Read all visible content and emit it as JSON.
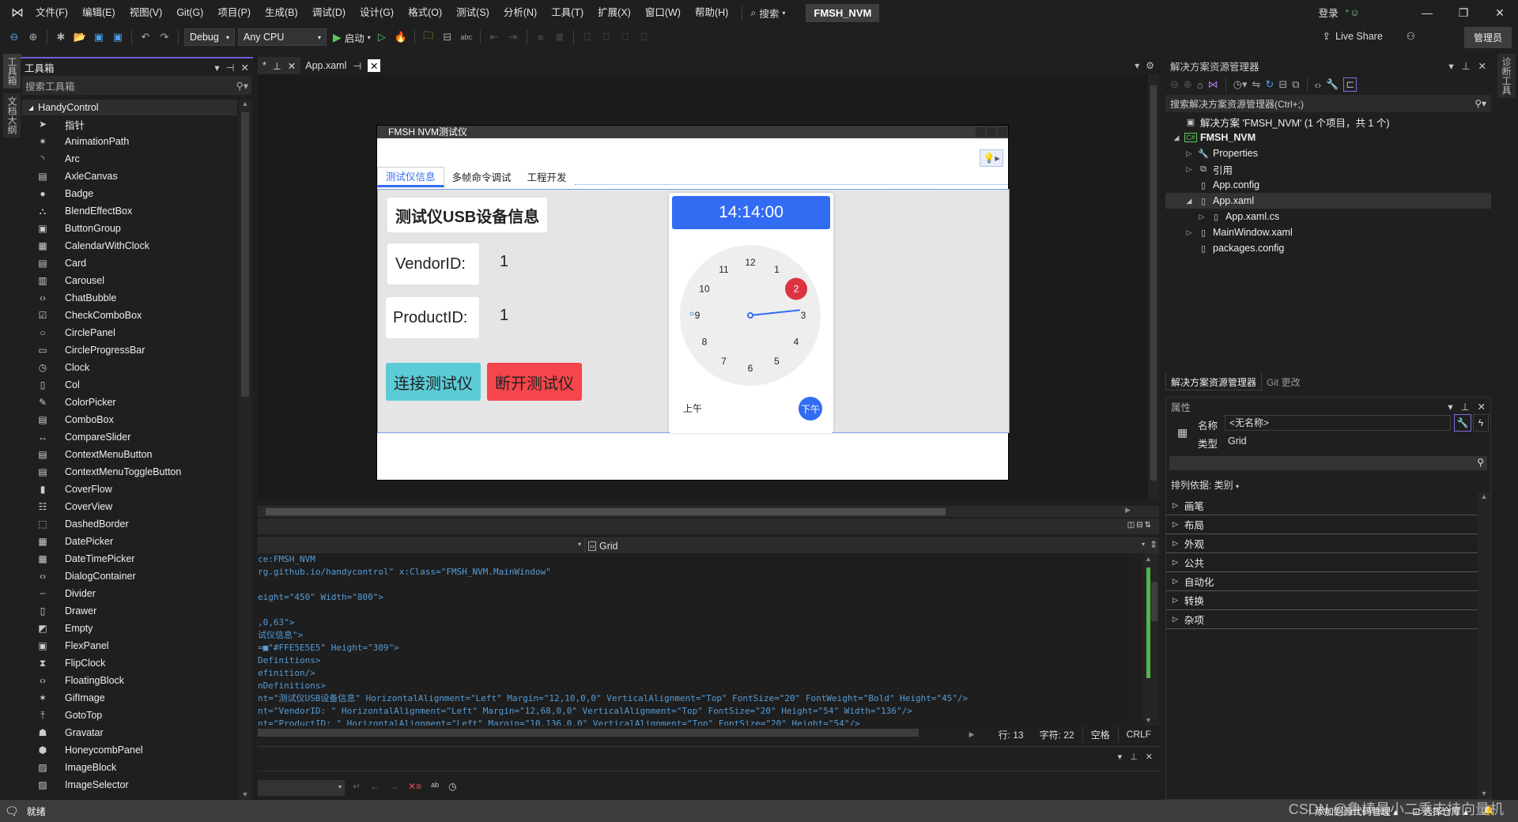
{
  "menubar": {
    "items": [
      "文件(F)",
      "编辑(E)",
      "视图(V)",
      "Git(G)",
      "项目(P)",
      "生成(B)",
      "调试(D)",
      "设计(G)",
      "格式(O)",
      "测试(S)",
      "分析(N)",
      "工具(T)",
      "扩展(X)",
      "窗口(W)",
      "帮助(H)"
    ],
    "search_label": "搜索",
    "solution_name": "FMSH_NVM",
    "login_label": "登录"
  },
  "toolbar": {
    "config": "Debug",
    "platform": "Any CPU",
    "start_label": "启动",
    "live_share": "Live Share",
    "admin_label": "管理员"
  },
  "left_tabs": [
    "工具箱",
    "文档大纲"
  ],
  "toolbox": {
    "title": "工具箱",
    "search_placeholder": "搜索工具箱",
    "group": "HandyControl",
    "items": [
      {
        "label": "指针",
        "icon": "pointer-icon",
        "glyph": "➤"
      },
      {
        "label": "AnimationPath",
        "icon": "animation-path-icon",
        "glyph": "✶"
      },
      {
        "label": "Arc",
        "icon": "arc-icon",
        "glyph": "◝"
      },
      {
        "label": "AxleCanvas",
        "icon": "axle-canvas-icon",
        "glyph": "▤"
      },
      {
        "label": "Badge",
        "icon": "badge-icon",
        "glyph": "●"
      },
      {
        "label": "BlendEffectBox",
        "icon": "blend-effect-icon",
        "glyph": "⛬"
      },
      {
        "label": "ButtonGroup",
        "icon": "button-group-icon",
        "glyph": "▣"
      },
      {
        "label": "CalendarWithClock",
        "icon": "calendar-clock-icon",
        "glyph": "▦"
      },
      {
        "label": "Card",
        "icon": "card-icon",
        "glyph": "▤"
      },
      {
        "label": "Carousel",
        "icon": "carousel-icon",
        "glyph": "▥"
      },
      {
        "label": "ChatBubble",
        "icon": "code-brackets-icon",
        "glyph": "‹›"
      },
      {
        "label": "CheckComboBox",
        "icon": "check-combo-icon",
        "glyph": "☑"
      },
      {
        "label": "CirclePanel",
        "icon": "circle-panel-icon",
        "glyph": "○"
      },
      {
        "label": "CircleProgressBar",
        "icon": "progress-bar-icon",
        "glyph": "▭"
      },
      {
        "label": "Clock",
        "icon": "clock-icon",
        "glyph": "◷"
      },
      {
        "label": "Col",
        "icon": "column-icon",
        "glyph": "▯"
      },
      {
        "label": "ColorPicker",
        "icon": "color-picker-icon",
        "glyph": "✎"
      },
      {
        "label": "ComboBox",
        "icon": "combobox-icon",
        "glyph": "▤"
      },
      {
        "label": "CompareSlider",
        "icon": "compare-slider-icon",
        "glyph": "↔"
      },
      {
        "label": "ContextMenuButton",
        "icon": "context-menu-icon",
        "glyph": "▤"
      },
      {
        "label": "ContextMenuToggleButton",
        "icon": "context-menu-toggle-icon",
        "glyph": "▤"
      },
      {
        "label": "CoverFlow",
        "icon": "cover-flow-icon",
        "glyph": "▮"
      },
      {
        "label": "CoverView",
        "icon": "cover-view-icon",
        "glyph": "☷"
      },
      {
        "label": "DashedBorder",
        "icon": "dashed-border-icon",
        "glyph": "⬚"
      },
      {
        "label": "DatePicker",
        "icon": "date-picker-icon",
        "glyph": "▦"
      },
      {
        "label": "DateTimePicker",
        "icon": "datetime-picker-icon",
        "glyph": "▦"
      },
      {
        "label": "DialogContainer",
        "icon": "code-brackets-icon",
        "glyph": "‹›"
      },
      {
        "label": "Divider",
        "icon": "divider-icon",
        "glyph": "┄"
      },
      {
        "label": "Drawer",
        "icon": "drawer-icon",
        "glyph": "▯"
      },
      {
        "label": "Empty",
        "icon": "empty-icon",
        "glyph": "◩"
      },
      {
        "label": "FlexPanel",
        "icon": "flex-panel-icon",
        "glyph": "▣"
      },
      {
        "label": "FlipClock",
        "icon": "flip-clock-icon",
        "glyph": "⧗"
      },
      {
        "label": "FloatingBlock",
        "icon": "code-brackets-icon",
        "glyph": "‹›"
      },
      {
        "label": "GifImage",
        "icon": "gif-image-icon",
        "glyph": "✶"
      },
      {
        "label": "GotoTop",
        "icon": "goto-top-icon",
        "glyph": "⤒"
      },
      {
        "label": "Gravatar",
        "icon": "gravatar-icon",
        "glyph": "☗"
      },
      {
        "label": "HoneycombPanel",
        "icon": "honeycomb-icon",
        "glyph": "⬢"
      },
      {
        "label": "ImageBlock",
        "icon": "image-block-icon",
        "glyph": "▨"
      },
      {
        "label": "ImageSelector",
        "icon": "image-selector-icon",
        "glyph": "▨"
      }
    ]
  },
  "doc_tabs": [
    {
      "label": "*",
      "active": false
    },
    {
      "label": "App.xaml",
      "active": true
    }
  ],
  "wpf_window": {
    "title": "FMSH NVM测试仪",
    "tabs": [
      "测试仪信息",
      "多帧命令调试",
      "工程开发"
    ],
    "active_tab": 0,
    "heading": "测试仪USB设备信息",
    "vendor_label": "VendorID:",
    "vendor_value": "1",
    "product_label": "ProductID:",
    "product_value": "1",
    "connect_button": "连接测试仪",
    "disconnect_button": "断开测试仪",
    "colors": {
      "connect": "#5bcbd6",
      "disconnect": "#f5464b",
      "accent": "#326cf3",
      "grid_bg": "#e5e5e5"
    },
    "clock": {
      "time": "14:14:00",
      "hour": 2,
      "minute": 14,
      "numbers": [
        "12",
        "1",
        "2",
        "3",
        "4",
        "5",
        "6",
        "7",
        "8",
        "9",
        "10",
        "11"
      ],
      "selected_number": "2",
      "am_label": "上午",
      "pm_label": "下午",
      "pm_selected": true
    }
  },
  "xaml_editor": {
    "element_selector": "Grid",
    "lines": [
      "ce:FMSH_NVM",
      "rg.github.io/handycontrol\" x:Class=\"FMSH_NVM.MainWindow\"",
      "",
      "eight=\"450\" Width=\"800\">",
      "",
      ",0,63\">",
      "试仪信息\">",
      "=■\"#FFE5E5E5\" Height=\"309\">",
      "Definitions>",
      "efinition/>",
      "nDefinitions>",
      "nt=\"测试仪USB设备信息\" HorizontalAlignment=\"Left\" Margin=\"12,10,0,0\" VerticalAlignment=\"Top\" FontSize=\"20\" FontWeight=\"Bold\" Height=\"45\"/>",
      "nt=\"VendorID: \" HorizontalAlignment=\"Left\" Margin=\"12,68,0,0\" VerticalAlignment=\"Top\" FontSize=\"20\" Height=\"54\" Width=\"136\"/>",
      "nt=\"ProductID: \" HorizontalAlignment=\"Left\" Margin=\"10,136,0,0\" VerticalAlignment=\"Top\" FontSize=\"20\" Height=\"54\"/>"
    ],
    "status": {
      "line": "行: 13",
      "char": "字符: 22",
      "indent": "空格",
      "eol": "CRLF"
    }
  },
  "solution_explorer": {
    "title": "解决方案资源管理器",
    "search_placeholder": "搜索解决方案资源管理器(Ctrl+;)",
    "tree": [
      {
        "label": "解决方案 'FMSH_NVM' (1 个项目，共 1 个)",
        "level": 0,
        "arrow": "",
        "icon": "solution-icon",
        "glyph": "▣",
        "bold": false,
        "selected": false
      },
      {
        "label": "FMSH_NVM",
        "level": 0,
        "arrow": "◢",
        "icon": "csharp-project-icon",
        "glyph": "C#",
        "bold": true,
        "selected": false
      },
      {
        "label": "Properties",
        "level": 1,
        "arrow": "▷",
        "icon": "wrench-icon",
        "glyph": "🔧",
        "bold": false,
        "selected": false
      },
      {
        "label": "引用",
        "level": 1,
        "arrow": "▷",
        "icon": "references-icon",
        "glyph": "⧉",
        "bold": false,
        "selected": false
      },
      {
        "label": "App.config",
        "level": 1,
        "arrow": "",
        "icon": "config-file-icon",
        "glyph": "▯",
        "bold": false,
        "selected": false
      },
      {
        "label": "App.xaml",
        "level": 1,
        "arrow": "◢",
        "icon": "xaml-file-icon",
        "glyph": "▯",
        "bold": false,
        "selected": true
      },
      {
        "label": "App.xaml.cs",
        "level": 2,
        "arrow": "▷",
        "icon": "cs-file-icon",
        "glyph": "▯",
        "bold": false,
        "selected": false
      },
      {
        "label": "MainWindow.xaml",
        "level": 1,
        "arrow": "▷",
        "icon": "xaml-file-icon",
        "glyph": "▯",
        "bold": false,
        "selected": false
      },
      {
        "label": "packages.config",
        "level": 1,
        "arrow": "",
        "icon": "config-file-icon",
        "glyph": "▯",
        "bold": false,
        "selected": false
      }
    ],
    "bottom_tabs": [
      "解决方案资源管理器",
      "Git 更改"
    ]
  },
  "properties": {
    "title": "属性",
    "name_label": "名称",
    "name_value": "<无名称>",
    "type_label": "类型",
    "type_value": "Grid",
    "sort_label": "排列依据: 类别",
    "categories": [
      "画笔",
      "布局",
      "外观",
      "公共",
      "自动化",
      "转换",
      "杂项"
    ]
  },
  "right_tabs": [
    "诊断工具"
  ],
  "statusbar": {
    "ready": "就绪",
    "add_source_control": "添加到源代码管理",
    "select_repo": "选择仓库",
    "watermark": "CSDN @鲁棒最小二乘支持向量机"
  }
}
